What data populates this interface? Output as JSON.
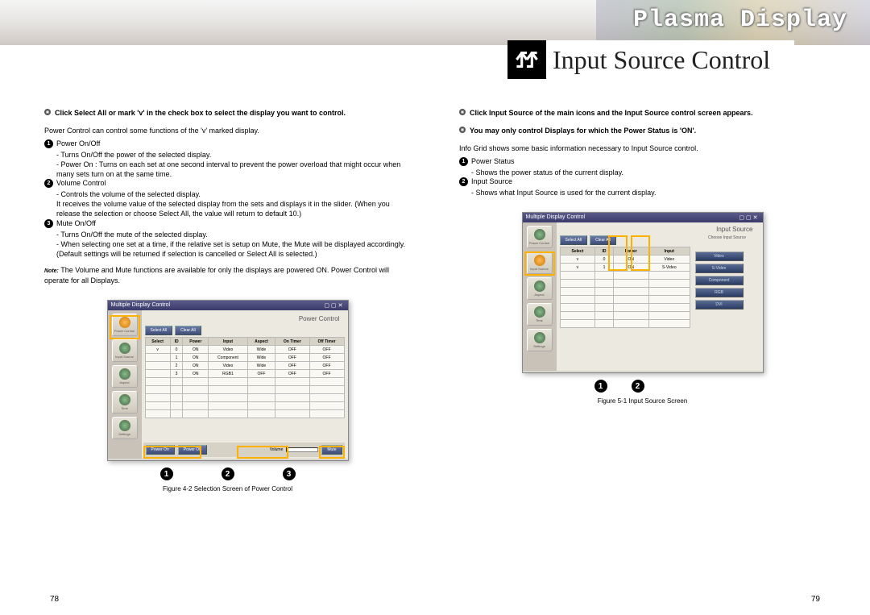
{
  "header": {
    "brand": "Plasma Display",
    "section_title": "Input Source Control"
  },
  "left": {
    "note": "Click Select All or mark 'v' in the check box to select the display you want to control.",
    "intro": "Power Control can control some functions of the 'v' marked display.",
    "items": [
      {
        "title": "Power On/Off",
        "lines": [
          "- Turns On/Off the power of the selected display.",
          "- Power On : Turns on each set at one second interval to prevent the power overload that might occur when many sets turn on at the same time."
        ]
      },
      {
        "title": "Volume Control",
        "lines": [
          "- Controls the volume of the selected display.",
          "  It receives the volume value of the selected display from the sets and displays it in the slider. (When you release the selection or choose Select All, the value will return to default 10.)"
        ]
      },
      {
        "title": "Mute On/Off",
        "lines": [
          "- Turns On/Off the mute of the selected display.",
          "- When selecting one set at a time, if the relative set is setup on Mute, the Mute will be displayed accordingly. (Default settings will be returned if selection is cancelled or Select All is selected.)"
        ]
      }
    ],
    "footnote": "The Volume and Mute functions are available for only the displays are powered ON. Power Control will operate for all Displays.",
    "window_title": "Multiple Display Control",
    "screen_label": "Power Control",
    "side_labels": [
      "Power Control",
      "Input Source",
      "Aspect",
      "Time",
      "Settings"
    ],
    "top_buttons": [
      "Select All",
      "Clear All"
    ],
    "table_head": [
      "Select",
      "ID",
      "Power",
      "Input",
      "Aspect",
      "On Timer",
      "Off Timer"
    ],
    "table_rows": [
      [
        "v",
        "0",
        "ON",
        "Video",
        "Wide",
        "OFF",
        "OFF"
      ],
      [
        "",
        "1",
        "ON",
        "Component",
        "Wide",
        "OFF",
        "OFF"
      ],
      [
        "",
        "2",
        "ON",
        "Video",
        "Wide",
        "OFF",
        "OFF"
      ],
      [
        "",
        "3",
        "ON",
        "RGB1",
        "OFF",
        "OFF",
        "OFF"
      ]
    ],
    "toolbar": {
      "btn1": "Power On",
      "btn2": "Power Off",
      "vol_label": "Volume",
      "mute": "Mute"
    },
    "caption": "Figure 4-2 Selection Screen of Power Control"
  },
  "right": {
    "note1": "Click Input Source of the main icons and the Input Source control screen appears.",
    "note2": "You may only control Displays for which the Power Status is 'ON'.",
    "intro": "Info Grid shows some basic information necessary to Input Source control.",
    "items": [
      {
        "title": "Power Status",
        "lines": [
          "- Shows the power status of the current display."
        ]
      },
      {
        "title": "Input Source",
        "lines": [
          "- Shows what Input Source is used for the current display."
        ]
      }
    ],
    "window_title": "Multiple Display Control",
    "screen_label": "Input Source",
    "side_labels": [
      "Power Control",
      "Input Source",
      "Aspect",
      "Time",
      "Settings"
    ],
    "top_buttons": [
      "Select All",
      "Clear All"
    ],
    "table_head": [
      "Select",
      "ID",
      "Power",
      "Input"
    ],
    "table_rows": [
      [
        "v",
        "0",
        "ON",
        "Video"
      ],
      [
        "v",
        "1",
        "ON",
        "S-Video"
      ]
    ],
    "panel_title": "Choose Input Source",
    "source_buttons": [
      "Video",
      "S-Video",
      "Component",
      "RGB",
      "DVI"
    ],
    "caption": "Figure 5-1 Input Source Screen"
  },
  "page_left": "78",
  "page_right": "79"
}
